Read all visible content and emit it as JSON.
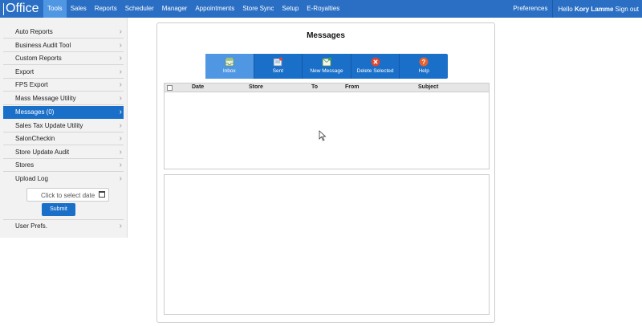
{
  "app": {
    "logo": "Office"
  },
  "nav": {
    "items": [
      "Tools",
      "Sales",
      "Reports",
      "Scheduler",
      "Manager",
      "Appointments",
      "Store Sync",
      "Setup",
      "E-Royalties"
    ],
    "active": "Tools"
  },
  "header": {
    "preferences": "Preferences",
    "hello": "Hello",
    "user": "Kory Lamme",
    "signout": "Sign out"
  },
  "sidebar": {
    "items": [
      {
        "label": "Auto Reports"
      },
      {
        "label": "Business Audit Tool"
      },
      {
        "label": "Custom Reports"
      },
      {
        "label": "Export"
      },
      {
        "label": "FPS Export"
      },
      {
        "label": "Mass Message Utility"
      },
      {
        "label": "Messages (0)"
      },
      {
        "label": "Sales Tax Update Utility"
      },
      {
        "label": "SalonCheckin"
      },
      {
        "label": "Store Update Audit"
      },
      {
        "label": "Stores"
      },
      {
        "label": "Upload Log"
      }
    ],
    "active_index": 6,
    "date_placeholder": "Click to select date",
    "submit": "Submit",
    "user_prefs": "User Prefs."
  },
  "messages": {
    "title": "Messages",
    "toolbar": [
      {
        "label": "Inbox",
        "icon": "inbox-icon"
      },
      {
        "label": "Sent",
        "icon": "sent-icon"
      },
      {
        "label": "New Message",
        "icon": "new-message-icon"
      },
      {
        "label": "Delete Selected",
        "icon": "delete-icon"
      },
      {
        "label": "Help",
        "icon": "help-icon"
      }
    ],
    "columns": [
      "Date",
      "Store",
      "To",
      "From",
      "Subject"
    ]
  },
  "colors": {
    "primary": "#2a6fc4",
    "active": "#4f97e3",
    "sidebar_active": "#1a6fc9",
    "delete": "#e0452d",
    "help": "#e8602c"
  }
}
